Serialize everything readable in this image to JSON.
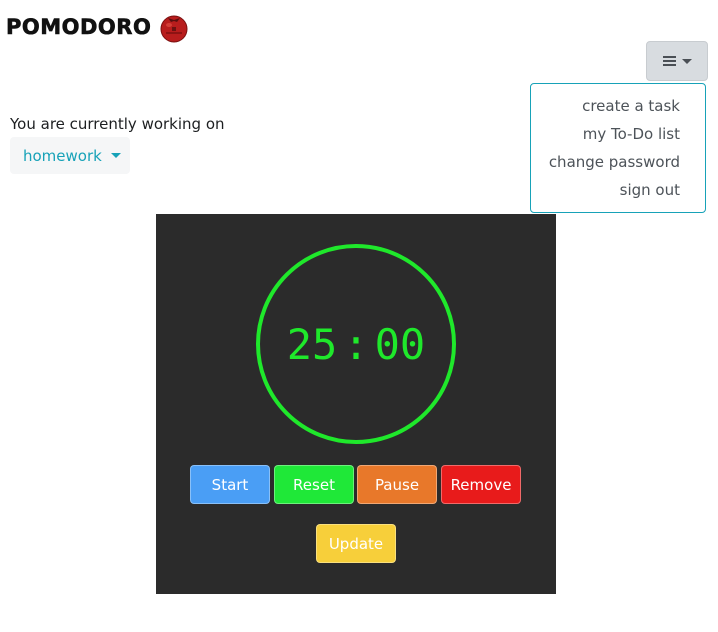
{
  "brand": {
    "title": "POMODORO",
    "logo_icon": "tomato-icon"
  },
  "nav": {
    "toggle_icon": "hamburger-icon",
    "menu": [
      {
        "label": "create a task"
      },
      {
        "label": "my To-Do list"
      },
      {
        "label": "change password"
      },
      {
        "label": "sign out"
      }
    ]
  },
  "task": {
    "prompt": "You are currently working on",
    "selected": "homework"
  },
  "timer": {
    "minutes": "25",
    "separator": ":",
    "seconds": "00",
    "ring_color": "#1fe82b"
  },
  "controls": {
    "start": "Start",
    "reset": "Reset",
    "pause": "Pause",
    "remove": "Remove",
    "update": "Update"
  },
  "colors": {
    "panel_bg": "#2b2b2b",
    "accent": "#17a2b8",
    "start": "#4a9ef5",
    "reset": "#1fe838",
    "pause": "#e8782a",
    "remove": "#e81b1b",
    "update": "#f7cf3a"
  }
}
